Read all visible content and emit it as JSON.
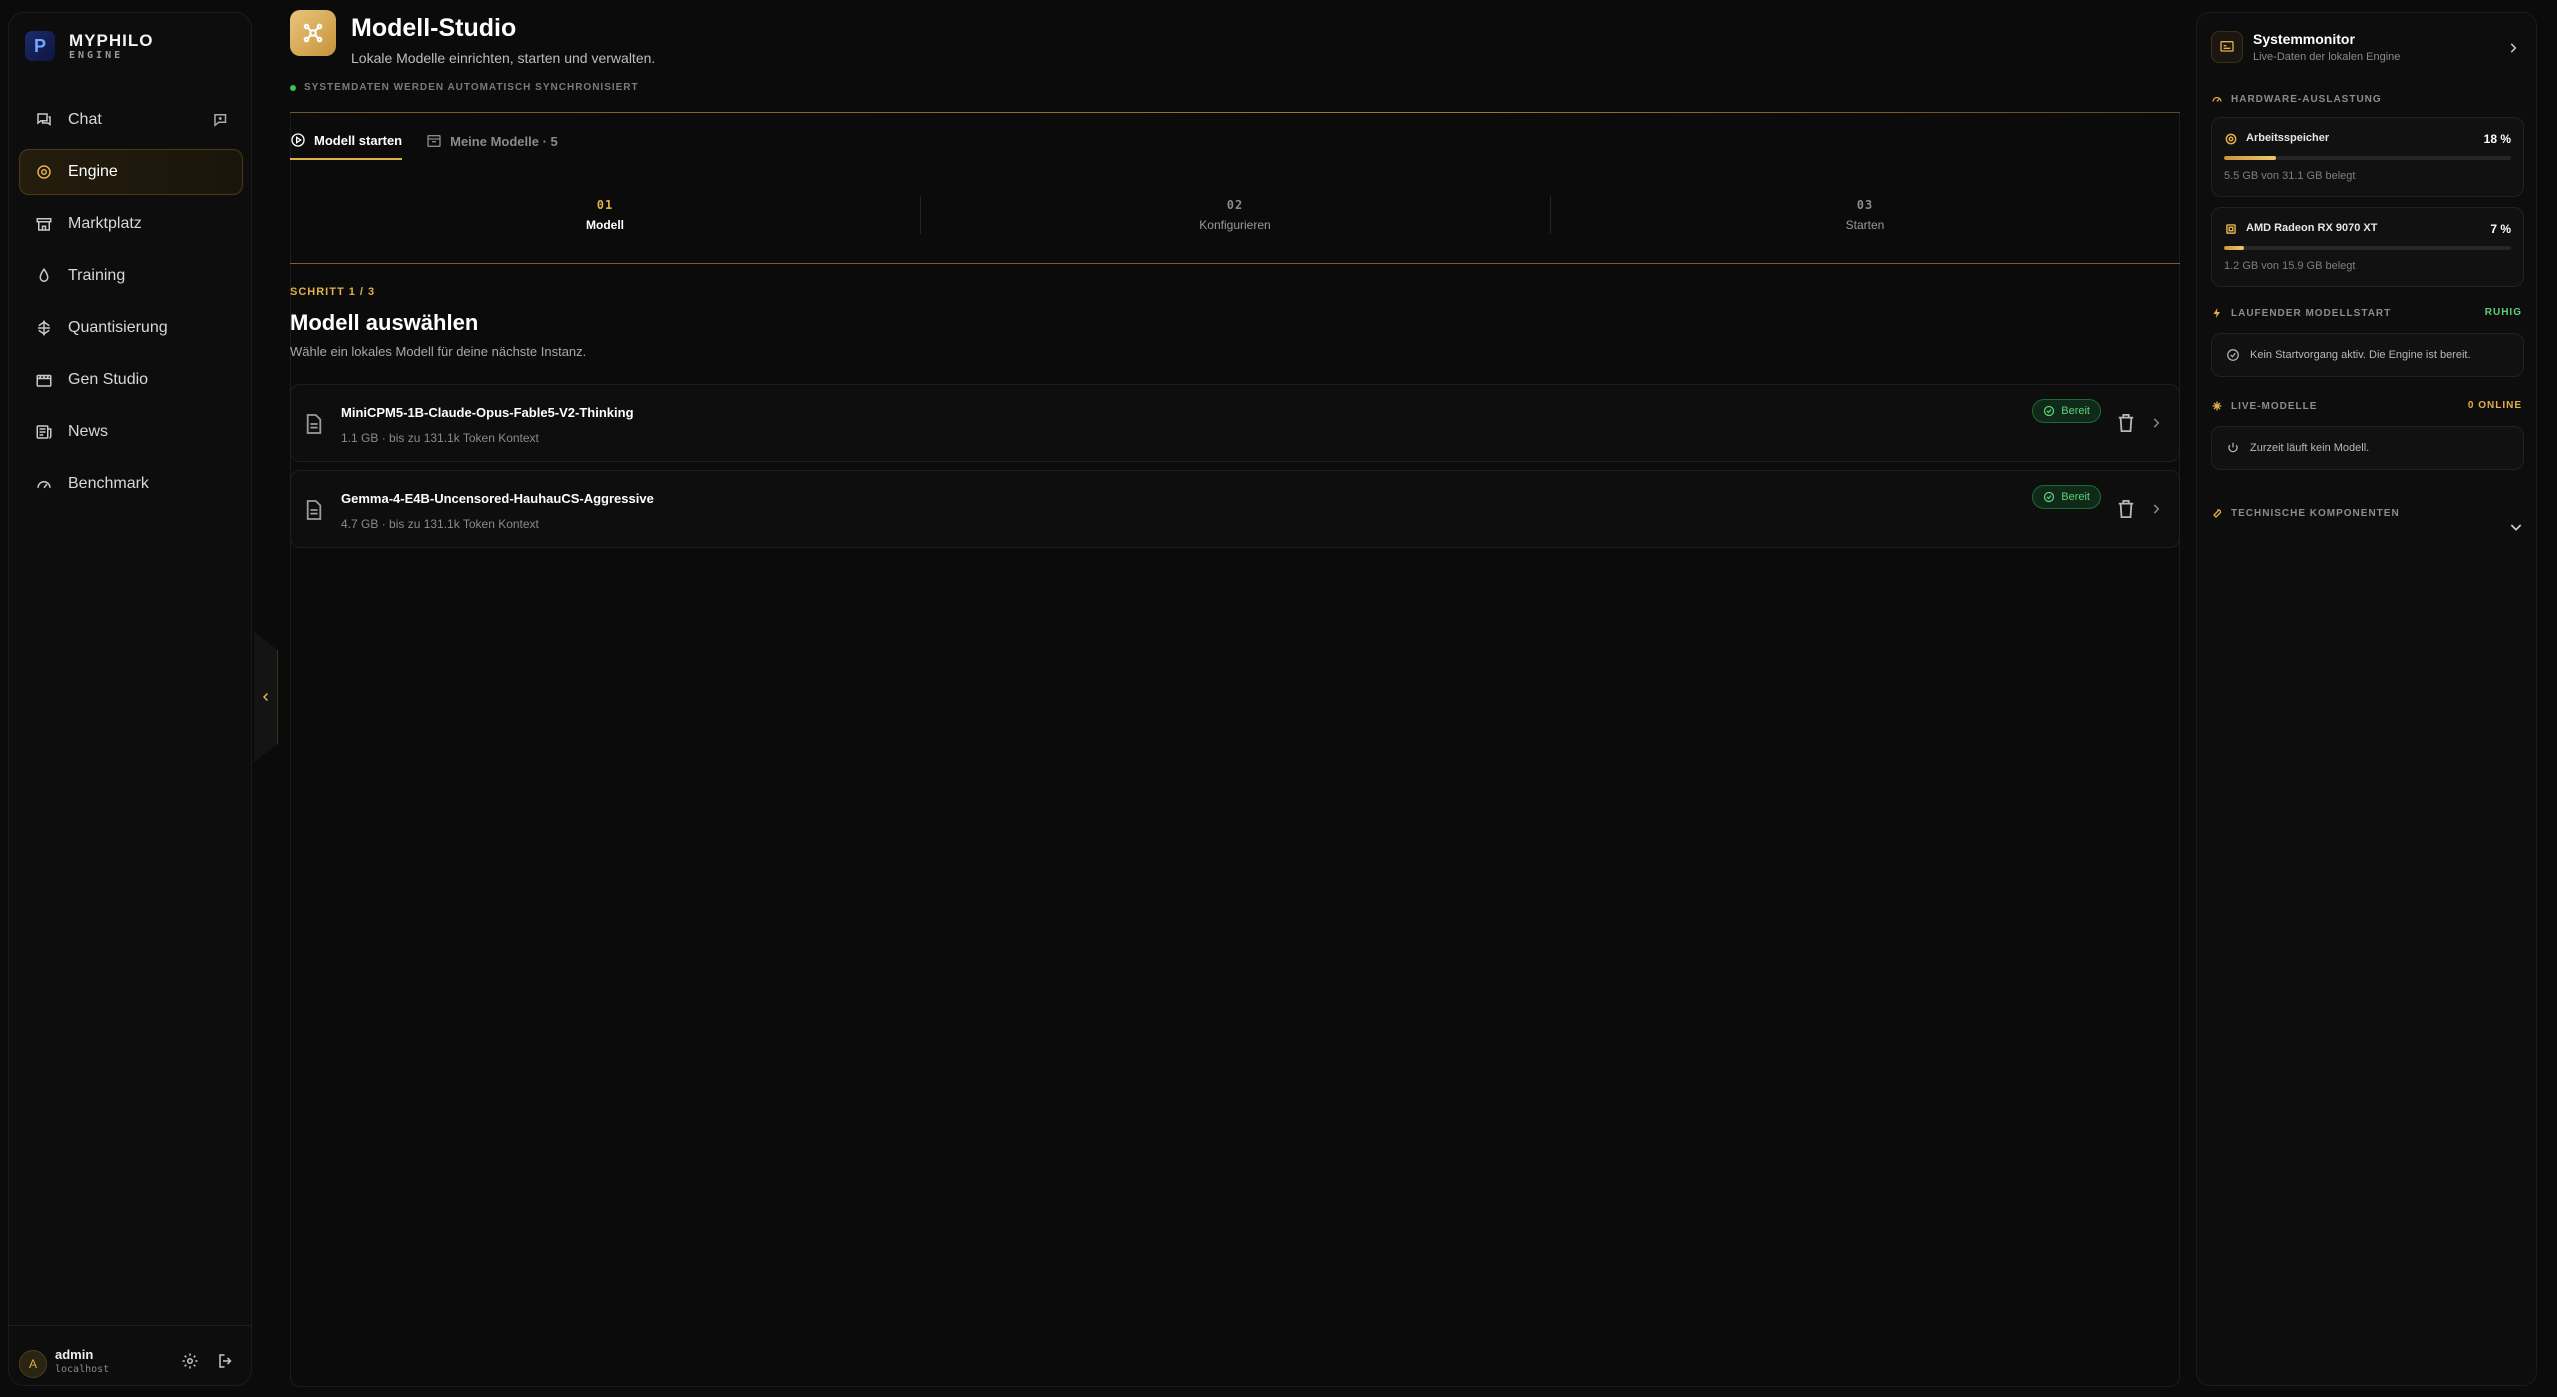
{
  "brand": {
    "name": "MYPHILO",
    "sub": "ENGINE"
  },
  "sidebar": {
    "items": [
      {
        "label": "Chat",
        "icon": "chat-icon"
      },
      {
        "label": "Engine",
        "icon": "engine-icon"
      },
      {
        "label": "Marktplatz",
        "icon": "store-icon"
      },
      {
        "label": "Training",
        "icon": "training-icon"
      },
      {
        "label": "Quantisierung",
        "icon": "quantize-icon"
      },
      {
        "label": "Gen Studio",
        "icon": "clapper-icon"
      },
      {
        "label": "News",
        "icon": "news-icon"
      },
      {
        "label": "Benchmark",
        "icon": "gauge-icon"
      }
    ],
    "active": "Engine"
  },
  "user": {
    "initial": "A",
    "name": "admin",
    "host": "localhost"
  },
  "header": {
    "title": "Modell-Studio",
    "subtitle": "Lokale Modelle einrichten, starten und verwalten.",
    "sync": "SYSTEMDATEN WERDEN AUTOMATISCH SYNCHRONISIERT"
  },
  "tabs": [
    {
      "label": "Modell starten",
      "active": true
    },
    {
      "label": "Meine Modelle · 5",
      "active": false
    }
  ],
  "steps": [
    {
      "num": "01",
      "label": "Modell"
    },
    {
      "num": "02",
      "label": "Konfigurieren"
    },
    {
      "num": "03",
      "label": "Starten"
    }
  ],
  "step_section": {
    "count": "SCHRITT 1 / 3",
    "title": "Modell auswählen",
    "subtitle": "Wähle ein lokales Modell für deine nächste Instanz."
  },
  "models": [
    {
      "name": "MiniCPM5-1B-Claude-Opus-Fable5-V2-Thinking",
      "meta": "1.1 GB · bis zu 131.1k Token Kontext",
      "status": "Bereit"
    },
    {
      "name": "Gemma-4-E4B-Uncensored-HauhauCS-Aggressive",
      "meta": "4.7 GB · bis zu 131.1k Token Kontext",
      "status": "Bereit"
    }
  ],
  "monitor": {
    "title": "Systemmonitor",
    "subtitle": "Live-Daten der lokalen Engine",
    "hardware_label": "HARDWARE-AUSLASTUNG",
    "hardware": [
      {
        "name": "Arbeitsspeicher",
        "pct_text": "18 %",
        "pct": 0.18,
        "used": "5.5 GB von 31.1 GB belegt"
      },
      {
        "name": "AMD Radeon RX 9070 XT",
        "pct_text": "7 %",
        "pct": 0.07,
        "used": "1.2 GB von 15.9 GB belegt"
      }
    ],
    "start_label": "LAUFENDER MODELLSTART",
    "start_status": "RUHIG",
    "start_text": "Kein Startvorgang aktiv. Die Engine ist bereit.",
    "live_label": "LIVE-MODELLE",
    "live_status": "0 ONLINE",
    "live_text": "Zurzeit läuft kein Modell.",
    "tech_label": "TECHNISCHE KOMPONENTEN"
  },
  "colors": {
    "accent": "#e2b04a",
    "ok": "#5fd07a",
    "bg": "#0b0b0b"
  }
}
